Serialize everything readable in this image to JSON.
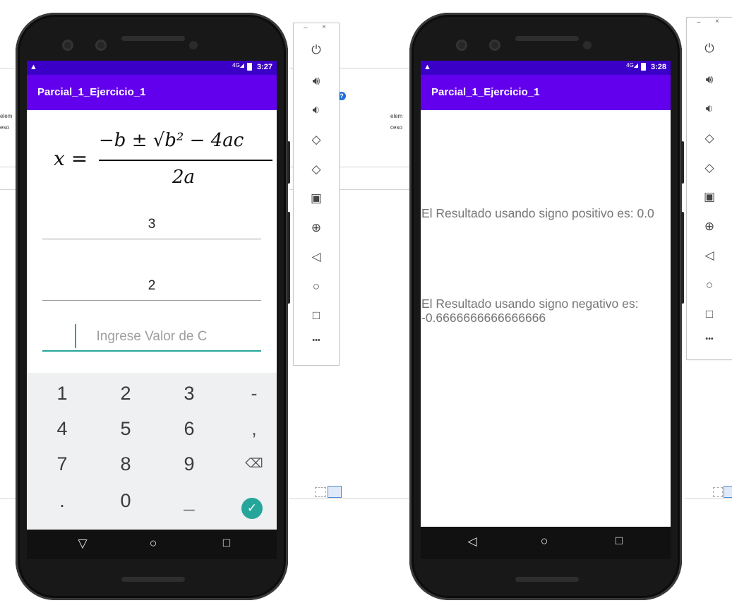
{
  "left_device": {
    "status": {
      "time": "3:27",
      "network": "4G",
      "warning_icon": "warning-icon"
    },
    "app_title": "Parcial_1_Ejercicio_1",
    "formula": {
      "lhs": "x =",
      "numerator": "−b ± √b² − 4ac",
      "denominator": "2a"
    },
    "input_a": {
      "value": "3"
    },
    "input_b": {
      "value": "2"
    },
    "input_c": {
      "value": "",
      "placeholder": "Ingrese Valor de C"
    },
    "keypad": {
      "rows": [
        [
          "1",
          "2",
          "3",
          "-"
        ],
        [
          "4",
          "5",
          "6",
          ","
        ],
        [
          "7",
          "8",
          "9",
          "⌫"
        ],
        [
          ".",
          "0",
          "_",
          "✓"
        ]
      ]
    }
  },
  "right_device": {
    "status": {
      "time": "3:28",
      "network": "4G",
      "warning_icon": "warning-icon"
    },
    "app_title": "Parcial_1_Ejercicio_1",
    "result_positive": "El Resultado usando signo positivo es: 0.0",
    "result_negative": "El Resultado usando signo negativo es: -0.6666666666666666"
  },
  "emulator_toolbar": {
    "minimize": "–",
    "close": "×",
    "tools": [
      "power-icon",
      "volume-up-icon",
      "volume-down-icon",
      "rotate-left-icon",
      "rotate-right-icon",
      "camera-icon",
      "zoom-icon",
      "back-icon",
      "home-icon",
      "overview-icon",
      "more-icon"
    ],
    "more_label": "•••"
  },
  "background_fragments": {
    "left_1": "elem",
    "left_2": "eso",
    "right_1": "elem",
    "right_2": "ceso"
  },
  "colors": {
    "app_bar": "#6200ee",
    "status_bar": "#3b00c8",
    "accent": "#26a69a"
  }
}
